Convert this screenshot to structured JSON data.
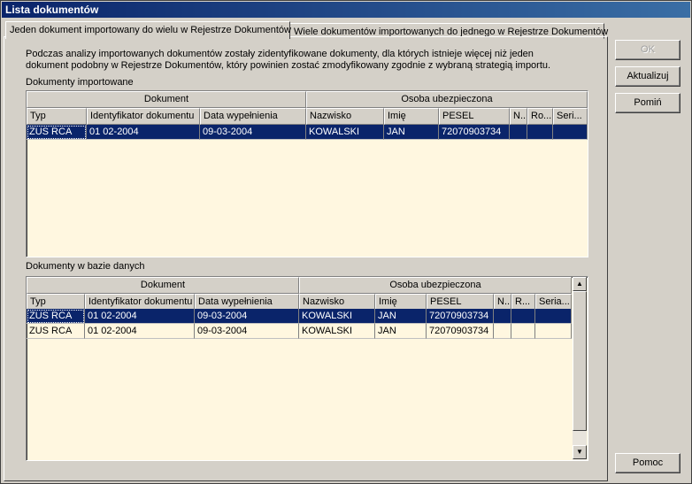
{
  "window": {
    "title": "Lista dokumentów"
  },
  "tabs": [
    {
      "label": "Jeden dokument importowany do wielu w Rejestrze Dokumentów",
      "active": true
    },
    {
      "label": "Wiele dokumentów importowanych do jednego w Rejestrze Dokumentów",
      "active": false
    }
  ],
  "description": "Podczas analizy importowanych dokumentów zostały zidentyfikowane dokumenty, dla których istnieje więcej niż jeden dokument podobny w Rejestrze Dokumentów, który powinien zostać zmodyfikowany zgodnie z wybraną strategią importu.",
  "imported": {
    "label": "Dokumenty importowane",
    "group_headers": [
      "Dokument",
      "Osoba ubezpieczona"
    ],
    "columns": [
      "Typ",
      "Identyfikator dokumentu",
      "Data wypełnienia",
      "Nazwisko",
      "Imię",
      "PESEL",
      "N...",
      "Ro...",
      "Seri..."
    ],
    "rows": [
      [
        "ZUS RCA",
        "01 02-2004",
        "09-03-2004",
        "KOWALSKI",
        "JAN",
        "72070903734",
        "",
        "",
        ""
      ]
    ]
  },
  "database": {
    "label": "Dokumenty w bazie danych",
    "group_headers": [
      "Dokument",
      "Osoba ubezpieczona"
    ],
    "columns": [
      "Typ",
      "Identyfikator dokumentu",
      "Data wypełnienia",
      "Nazwisko",
      "Imię",
      "PESEL",
      "N...",
      "R...",
      "Seria..."
    ],
    "rows": [
      [
        "ZUS RCA",
        "01 02-2004",
        "09-03-2004",
        "KOWALSKI",
        "JAN",
        "72070903734",
        "",
        "",
        ""
      ],
      [
        "ZUS RCA",
        "01 02-2004",
        "09-03-2004",
        "KOWALSKI",
        "JAN",
        "72070903734",
        "",
        "",
        ""
      ]
    ]
  },
  "buttons": {
    "ok": "OK",
    "refresh": "Aktualizuj",
    "skip": "Pomiń",
    "help": "Pomoc"
  },
  "scrollbar": {
    "up_icon": "arrow-up-icon",
    "down_icon": "arrow-down-icon"
  }
}
